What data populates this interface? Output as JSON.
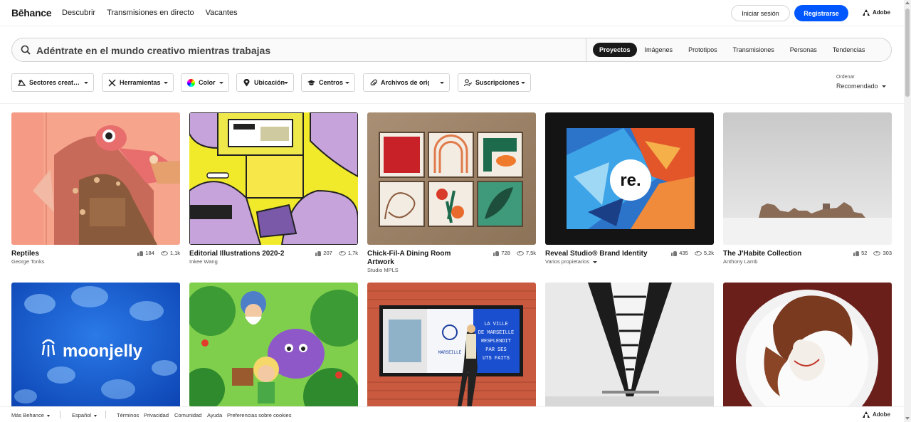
{
  "brand": {
    "logo": "Bēhance"
  },
  "nav": {
    "links": [
      "Descubrir",
      "Transmisiones en directo",
      "Vacantes"
    ],
    "login": "Iniciar sesión",
    "signup": "Registrarse",
    "adobe": "Adobe"
  },
  "search": {
    "placeholder": "Adéntrate en el mundo creativo mientras trabajas",
    "tabs": [
      "Proyectos",
      "Imágenes",
      "Prototipos",
      "Transmisiones",
      "Personas",
      "Tendencias"
    ],
    "active_tab": "Proyectos"
  },
  "filters": [
    "Sectores creat…",
    "Herramientas",
    "Color",
    "Ubicación",
    "Centros",
    "Archivos de orig",
    "Suscripciones"
  ],
  "sort": {
    "label": "Ordenar",
    "value": "Recomendado"
  },
  "projects": [
    {
      "title": "Reptiles",
      "owner": "George Tonks",
      "likes": "184",
      "views": "1,1k"
    },
    {
      "title": "Editorial Illustrations 2020-2",
      "owner": "Inkee Wang",
      "likes": "207",
      "views": "1,7k"
    },
    {
      "title": "Chick-Fil-A Dining Room Artwork",
      "owner": "Studio MPLS",
      "likes": "728",
      "views": "7,5k"
    },
    {
      "title": "Reveal Studio® Brand Identity",
      "owner": "Varios propietarios",
      "likes": "435",
      "views": "5,2k"
    },
    {
      "title": "The J'Habite Collection",
      "owner": "Anthony Lamb",
      "likes": "52",
      "views": "303"
    }
  ],
  "thumb_text": {
    "re": "re.",
    "moonjelly": "moonjelly",
    "poster_lines": [
      "LA VILLE",
      "DE MARSEILLE",
      "RESPLENDIT",
      "PAR SES",
      "UTS FAITS"
    ],
    "marseille": "MARSEILLE"
  },
  "footer": {
    "more": "Más Behance",
    "lang": "Español",
    "links": [
      "Términos",
      "Privacidad",
      "Comunidad",
      "Ayuda",
      "Preferencias sobre cookies"
    ],
    "adobe": "Adobe"
  }
}
